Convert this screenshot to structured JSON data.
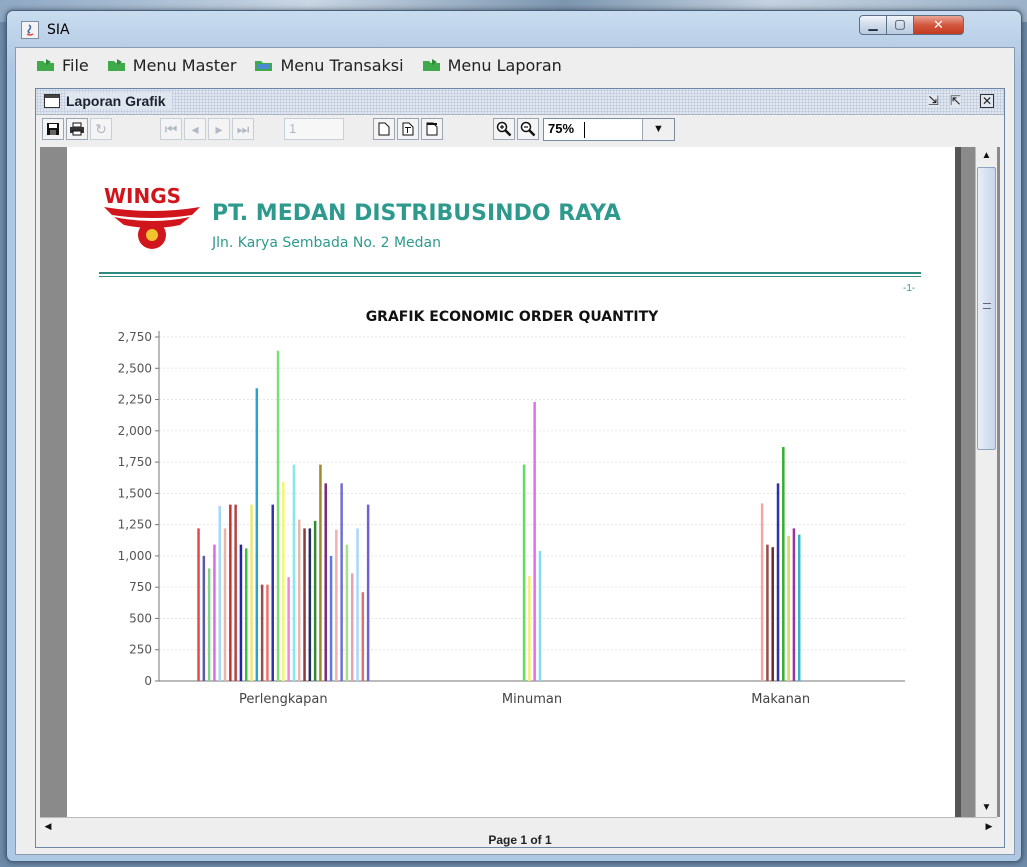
{
  "window": {
    "title": "SIA"
  },
  "menu": [
    "File",
    "Menu Master",
    "Menu Transaksi",
    "Menu Laporan"
  ],
  "frame": {
    "title": "Laporan Grafik"
  },
  "toolbar": {
    "page_input": "1",
    "zoom": "75%"
  },
  "report": {
    "company": "PT. MEDAN DISTRIBUSINDO RAYA",
    "address": "Jln. Karya Sembada No. 2 Medan",
    "page_marker": "-1-",
    "logo_text": "WINGS"
  },
  "status": "Page 1 of 1",
  "chart_data": {
    "type": "bar",
    "title": "GRAFIK ECONOMIC ORDER QUANTITY",
    "ylim": [
      0,
      2750
    ],
    "yticks": [
      "0",
      "250",
      "500",
      "750",
      "1,000",
      "1,250",
      "1,500",
      "1,750",
      "2,000",
      "2,250",
      "2,500",
      "2,750"
    ],
    "categories": [
      "Perlengkapan",
      "Minuman",
      "Makanan"
    ],
    "groups": [
      {
        "category": "Perlengkapan",
        "values": [
          1220,
          1000,
          900,
          1090,
          1400,
          1220,
          1410,
          1410,
          1090,
          1060,
          1410,
          2340,
          770,
          770,
          1410,
          2640,
          1590,
          830,
          1730,
          1290,
          1220,
          1220,
          1280,
          1730,
          1580,
          1000,
          1210,
          1580,
          1090,
          860,
          1220,
          710,
          1410
        ],
        "colors": [
          "#e8474b",
          "#5a5aa8",
          "#86d08a",
          "#d96ce0",
          "#a6d8f4",
          "#eab4a8",
          "#c9302c",
          "#b64242",
          "#2424a0",
          "#3ac23a",
          "#eaea70",
          "#2fa0c8",
          "#9b4a4a",
          "#f07070",
          "#3232a8",
          "#77e077",
          "#f5f570",
          "#f08ad8",
          "#88e8f0",
          "#e6b8b0",
          "#8b3b3b",
          "#2a2a6a",
          "#2e8b2e",
          "#9b8b2b",
          "#7a2a7a",
          "#5a7ae8",
          "#f0b0b0",
          "#7070d0",
          "#a8e088",
          "#e8a0b0",
          "#a8d8f8",
          "#e07070",
          "#7060d0"
        ]
      },
      {
        "category": "Minuman",
        "values": [
          1730,
          840,
          2230,
          1040
        ],
        "colors": [
          "#5ee05e",
          "#f0f07a",
          "#e070e8",
          "#88d8f0"
        ]
      },
      {
        "category": "Makanan",
        "values": [
          1420,
          1090,
          1070,
          1580,
          1870,
          1160,
          1220,
          1170
        ],
        "colors": [
          "#f0a8a0",
          "#9b4b4b",
          "#6a2a2a",
          "#3030a8",
          "#30b030",
          "#d8d860",
          "#a030a0",
          "#30b8c8"
        ]
      }
    ],
    "grid": true,
    "legend": "none"
  }
}
